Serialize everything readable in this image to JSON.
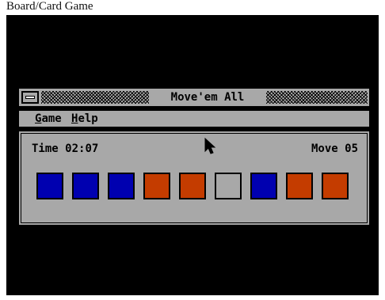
{
  "caption": "Board/Card Game",
  "window": {
    "title": "Move'em All"
  },
  "menu": {
    "game_label": "Game",
    "help_label": "Help"
  },
  "status": {
    "time_label": "Time",
    "time_value": "02:07",
    "move_label": "Move",
    "move_value": "05"
  },
  "colors": {
    "blue": "#0000b0",
    "red": "#c43c00",
    "empty": "#a8a8a8",
    "panel": "#a8a8a8",
    "background": "#000000"
  },
  "board": {
    "tiles": [
      "blue",
      "blue",
      "blue",
      "red",
      "red",
      "empty",
      "blue",
      "red",
      "red"
    ],
    "cursor_over_tile": 6
  }
}
